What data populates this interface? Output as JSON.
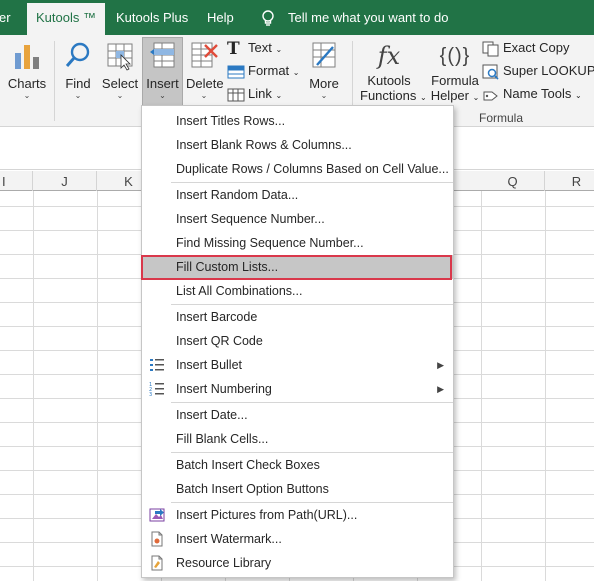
{
  "tabs": [
    "er",
    "Kutools ™",
    "Kutools Plus",
    "Help"
  ],
  "tell_me": "Tell me what you want to do",
  "ribbon": {
    "charts": "Charts",
    "find": "Find",
    "select": "Select",
    "insert": "Insert",
    "delete": "Delete",
    "text": "Text",
    "format": "Format",
    "link": "Link",
    "more": "More",
    "kutools_functions_1": "Kutools",
    "kutools_functions_2": "Functions",
    "formula_helper_1": "Formula",
    "formula_helper_2": "Helper",
    "exact_copy": "Exact Copy",
    "super_lookup": "Super LOOKUP",
    "name_tools": "Name Tools",
    "formula_group": "Formula"
  },
  "columns": [
    "I",
    "J",
    "K",
    "Q",
    "R"
  ],
  "menu": {
    "items": [
      "Insert Titles Rows...",
      "Insert Blank Rows & Columns...",
      "Duplicate Rows / Columns Based on Cell Value...",
      "Insert Random Data...",
      "Insert Sequence Number...",
      "Find Missing Sequence Number...",
      "Fill Custom Lists...",
      "List All Combinations...",
      "Insert Barcode",
      "Insert QR Code",
      "Insert Bullet",
      "Insert Numbering",
      "Insert Date...",
      "Fill Blank Cells...",
      "Batch Insert Check Boxes",
      "Batch Insert Option Buttons",
      "Insert Pictures from Path(URL)...",
      "Insert Watermark...",
      "Resource Library"
    ],
    "highlighted": "Fill Custom Lists..."
  },
  "colors": {
    "tab_bar": "#217346",
    "ribbon": "#f3f3f3",
    "highlight": "#c6c6c6",
    "callout": "#d9384b"
  }
}
